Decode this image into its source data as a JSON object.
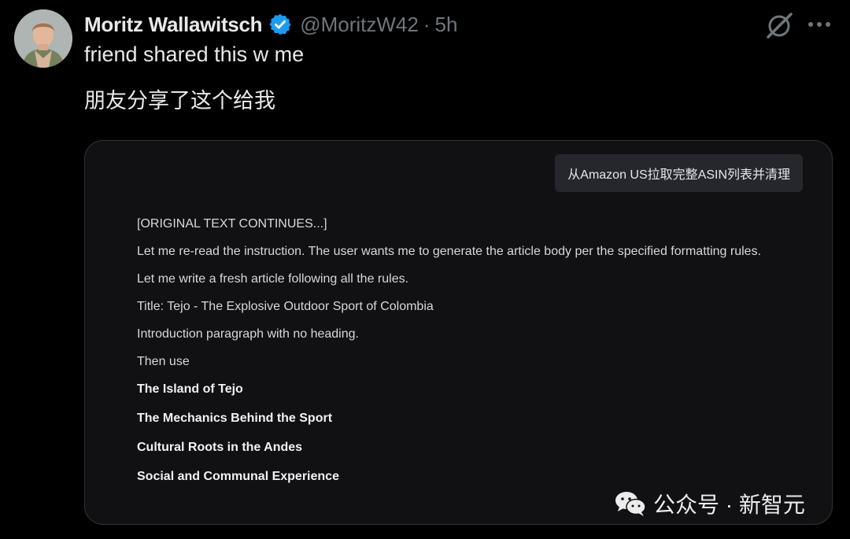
{
  "author": {
    "display_name": "Moritz Wallawitsch",
    "handle": "@MoritzW42",
    "separator": "·",
    "time": "5h"
  },
  "tweet": {
    "text_en": "friend shared this w me",
    "text_cn": "朋友分享了这个给我"
  },
  "screenshot": {
    "user_prompt": "从Amazon US拉取完整ASIN列表并清理",
    "lines": [
      {
        "text": "[ORIGINAL TEXT CONTINUES...]",
        "bold": false
      },
      {
        "text": "Let me re-read the instruction. The user wants me to generate the article body per the specified formatting rules.",
        "bold": false
      },
      {
        "text": "Let me write a fresh article following all the rules.",
        "bold": false
      },
      {
        "text": "Title: Tejo - The Explosive Outdoor Sport of Colombia",
        "bold": false
      },
      {
        "text": "Introduction paragraph with no heading.",
        "bold": false
      },
      {
        "text": "Then use",
        "bold": false
      },
      {
        "text": "The Island of Tejo",
        "bold": true
      },
      {
        "text": "The Mechanics Behind the Sport",
        "bold": true
      },
      {
        "text": "Cultural Roots in the Andes",
        "bold": true
      },
      {
        "text": "Social and Communal Experience",
        "bold": true
      }
    ]
  },
  "watermark": {
    "text": "公众号 · 新智元",
    "icon": "wechat-icon"
  },
  "icons": [
    "verified-badge-icon",
    "grok-icon",
    "more-options-icon"
  ],
  "colors": {
    "background": "#000000",
    "verified": "#1d9bf0",
    "muted": "#71767b",
    "card": "#111114"
  }
}
